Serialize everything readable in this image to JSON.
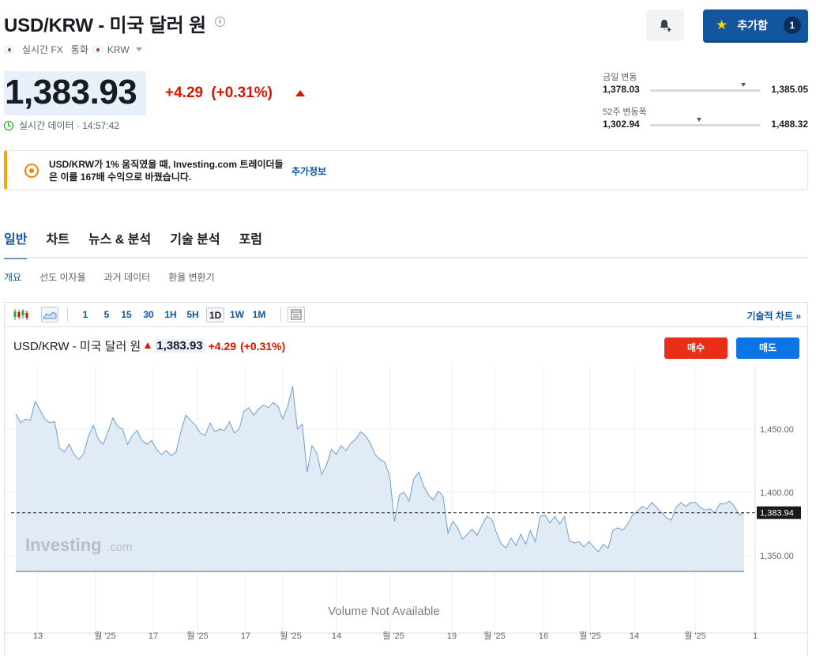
{
  "header": {
    "title": "USD/KRW - 미국 달러 원",
    "info_icon_glyph": "i",
    "meta": {
      "market": "실시간 FX",
      "category": "통화",
      "currency": "KRW"
    },
    "add_button_label": "추가함",
    "add_button_count": "1"
  },
  "quote": {
    "price": "1,383.93",
    "change": "+4.29",
    "change_pct": "(+0.31%)",
    "realtime_label": "실시간 데이터 · 14:57:42",
    "color_up": "#d91400"
  },
  "ranges": {
    "day": {
      "label": "금일 변동",
      "low": "1,378.03",
      "high": "1,385.05",
      "marker_fraction": 0.84
    },
    "week52": {
      "label": "52주 변동폭",
      "low": "1,302.94",
      "high": "1,488.32",
      "marker_fraction": 0.44
    }
  },
  "banner": {
    "text": "USD/KRW가 1% 움직였을 때, Investing.com 트레이더들은 이를 167배 수익으로 바꿨습니다.",
    "link": "추가정보"
  },
  "tabs": [
    "일반",
    "차트",
    "뉴스 & 분석",
    "기술 분석",
    "포럼"
  ],
  "subtabs": [
    "개요",
    "선도 이자율",
    "과거 데이터",
    "환율 변환기"
  ],
  "toolbar": {
    "timeframes": [
      "1",
      "5",
      "15",
      "30",
      "1H",
      "5H",
      "1D",
      "1W",
      "1M"
    ],
    "selected": "1D",
    "tech_chart_link": "기술적 차트 »"
  },
  "chart_header": {
    "name": "USD/KRW - 미국 달러 원",
    "price": "1,383.93",
    "change": "+4.29",
    "change_pct": "(+0.31%)",
    "buy_label": "매수",
    "sell_label": "매도"
  },
  "chart_data": {
    "type": "area",
    "y_ticks": [
      "1,450.00",
      "1,400.00",
      "1,350.00"
    ],
    "y_tick_values": [
      1450,
      1400,
      1350
    ],
    "current_value": 1383.94,
    "current_label": "1,383.94",
    "x_labels": [
      "13",
      "월 '25",
      "17",
      "월 '25",
      "17",
      "월 '25",
      "14",
      "월 '25",
      "19",
      "월 '25",
      "16",
      "월 '25",
      "14",
      "월 '25",
      "1"
    ],
    "volume_note": "Volume Not Available",
    "watermark": "Investing",
    "watermark_suffix": ".com",
    "values": [
      1462,
      1455,
      1458,
      1457,
      1472,
      1465,
      1458,
      1455,
      1456,
      1435,
      1432,
      1438,
      1430,
      1426,
      1431,
      1445,
      1453,
      1442,
      1438,
      1448,
      1459,
      1452,
      1450,
      1438,
      1445,
      1449,
      1441,
      1438,
      1441,
      1434,
      1430,
      1433,
      1429,
      1432,
      1448,
      1461,
      1457,
      1453,
      1447,
      1445,
      1455,
      1448,
      1450,
      1449,
      1456,
      1447,
      1450,
      1464,
      1467,
      1461,
      1466,
      1469,
      1467,
      1471,
      1468,
      1458,
      1468,
      1484,
      1450,
      1454,
      1416,
      1437,
      1431,
      1414,
      1422,
      1434,
      1430,
      1437,
      1433,
      1439,
      1442,
      1448,
      1445,
      1439,
      1430,
      1426,
      1424,
      1413,
      1377,
      1398,
      1400,
      1393,
      1411,
      1416,
      1405,
      1398,
      1394,
      1401,
      1397,
      1368,
      1377,
      1372,
      1363,
      1367,
      1371,
      1366,
      1374,
      1381,
      1379,
      1368,
      1359,
      1356,
      1364,
      1358,
      1367,
      1359,
      1370,
      1361,
      1381,
      1382,
      1376,
      1381,
      1375,
      1381,
      1362,
      1360,
      1361,
      1357,
      1361,
      1357,
      1353,
      1359,
      1356,
      1370,
      1372,
      1370,
      1375,
      1382,
      1385,
      1389,
      1387,
      1392,
      1388,
      1384,
      1380,
      1378,
      1388,
      1392,
      1389,
      1392,
      1392,
      1388,
      1386,
      1387,
      1384,
      1391,
      1391,
      1393,
      1389,
      1382,
      1384
    ]
  }
}
